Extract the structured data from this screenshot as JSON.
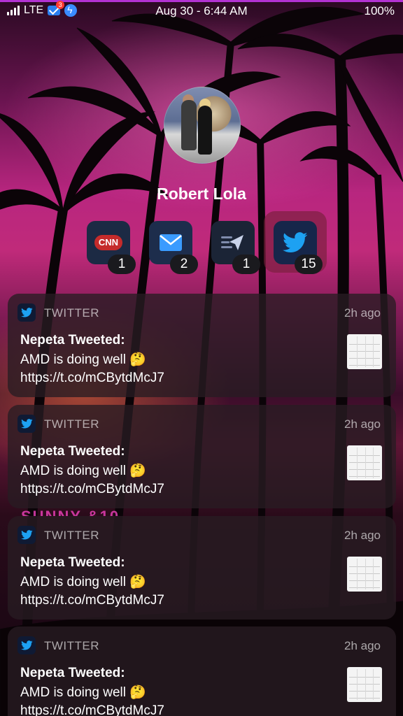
{
  "status_bar": {
    "carrier": "LTE",
    "mail_badge": "3",
    "datetime": "Aug 30 - 6:44 AM",
    "battery": "100%"
  },
  "profile": {
    "name": "Robert Lola"
  },
  "app_groups": [
    {
      "icon": "cnn-icon",
      "logo": "CNN",
      "count": "1"
    },
    {
      "icon": "mail-icon",
      "count": "2"
    },
    {
      "icon": "send-icon",
      "count": "1"
    },
    {
      "icon": "twitter-icon",
      "count": "15",
      "selected": true
    }
  ],
  "notifications": [
    {
      "app": "TWITTER",
      "time": "2h ago",
      "title": "Nepeta Tweeted:",
      "body": "AMD is doing well 🤔 https://t.co/mCBytdMcJ7"
    },
    {
      "app": "TWITTER",
      "time": "2h ago",
      "title": "Nepeta Tweeted:",
      "body": "AMD is doing well 🤔 https://t.co/mCBytdMcJ7"
    },
    {
      "app": "TWITTER",
      "time": "2h ago",
      "title": "Nepeta Tweeted:",
      "body": "AMD is doing well 🤔 https://t.co/mCBytdMcJ7"
    },
    {
      "app": "TWITTER",
      "time": "2h ago",
      "title": "Nepeta Tweeted:",
      "body": "AMD is doing well 🤔 https://t.co/mCBytdMcJ7"
    }
  ],
  "colors": {
    "twitter_blue": "#1da1f2",
    "cnn_red": "#c52b2b",
    "mail_blue": "#2a8cff"
  }
}
